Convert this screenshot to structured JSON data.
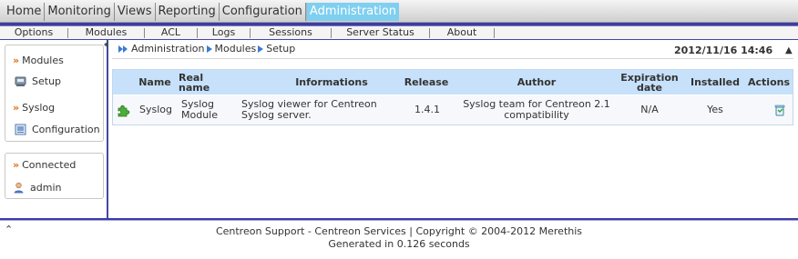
{
  "top_menu": {
    "tabs": [
      "Home",
      "Monitoring",
      "Views",
      "Reporting",
      "Configuration",
      "Administration"
    ],
    "active": "Administration"
  },
  "sub_menu": {
    "items": [
      "Options",
      "Modules",
      "ACL",
      "Logs",
      "Sessions",
      "Server Status",
      "About"
    ]
  },
  "sidebar": {
    "modules_title": "Modules",
    "setup_label": "Setup",
    "syslog_title": "Syslog",
    "configuration_label": "Configuration",
    "connected_title": "Connected",
    "user": "admin"
  },
  "breadcrumb": [
    "Administration",
    "Modules",
    "Setup"
  ],
  "datetime": "2012/11/16 14:46",
  "table": {
    "headers": {
      "name": "Name",
      "real_name_1": "Real",
      "real_name_2": "name",
      "informations": "Informations",
      "release": "Release",
      "author": "Author",
      "expiration_1": "Expiration",
      "expiration_2": "date",
      "installed": "Installed",
      "actions": "Actions"
    },
    "row": {
      "name": "Syslog",
      "real_name_1": "Syslog",
      "real_name_2": "Module",
      "info_1": "Syslog viewer for Centreon",
      "info_2": "Syslog server.",
      "release": "1.4.1",
      "author_1": "Syslog team for Centreon 2.1",
      "author_2": "compatibility",
      "expiration": "N/A",
      "installed": "Yes"
    }
  },
  "footer": {
    "line1": "Centreon Support - Centreon Services | Copyright © 2004-2012 Merethis",
    "line2": "Generated in 0.126 seconds"
  },
  "colors": {
    "accent": "#3c3ca6",
    "active_tab": "#7fcff0",
    "table_header": "#c7e1fb",
    "chevron": "#e26b10"
  },
  "icons": [
    "setup-icon",
    "configuration-icon",
    "user-icon",
    "module-puzzle-icon",
    "uninstall-trash-icon",
    "scroll-up-icon"
  ]
}
